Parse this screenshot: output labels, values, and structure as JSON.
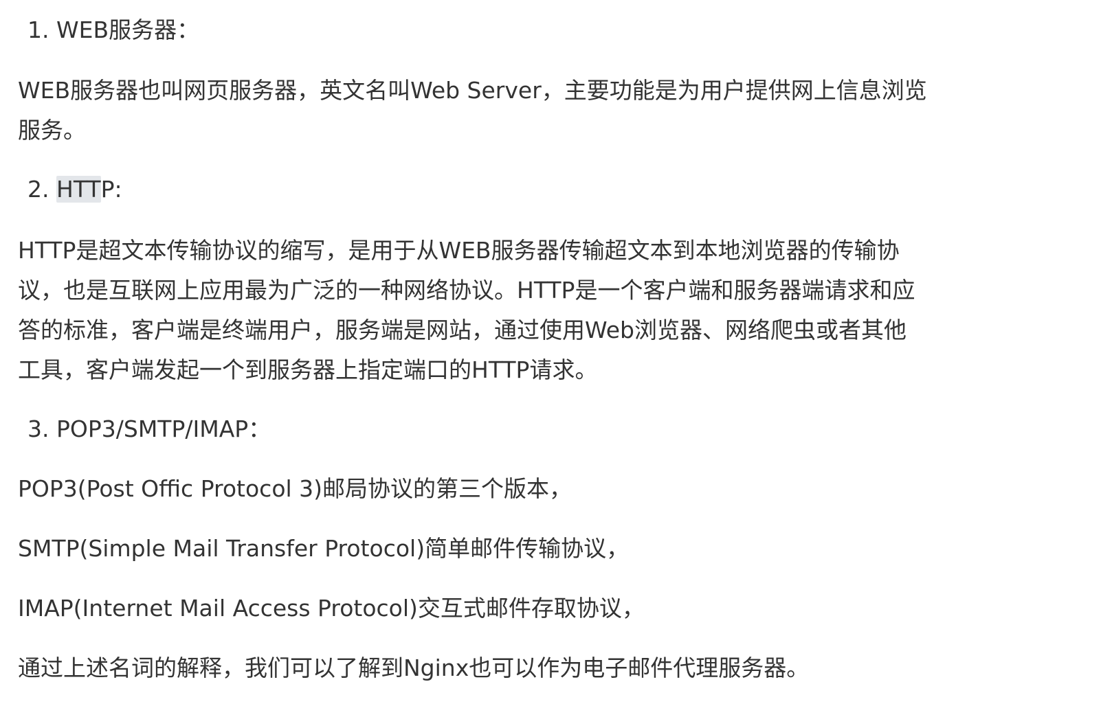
{
  "sections": [
    {
      "number": "1.",
      "title": "WEB服务器：",
      "paragraph_lines": [
        "WEB服务器也叫网页服务器，英文名叫Web Server，主要功能是为用户提供网上信息浏览",
        "服务。"
      ]
    },
    {
      "number": "2.",
      "title_highlighted": "HTT",
      "title_rest": "P:",
      "paragraph_lines": [
        "HTTP是超文本传输协议的缩写，是用于从WEB服务器传输超文本到本地浏览器的传输协",
        "议，也是互联网上应用最为广泛的一种网络协议。HTTP是一个客户端和服务器端请求和应",
        "答的标准，客户端是终端用户，服务端是网站，通过使用Web浏览器、网络爬虫或者其他",
        "工具，客户端发起一个到服务器上指定端口的HTTP请求。"
      ]
    },
    {
      "number": "3.",
      "title": "POP3/SMTP/IMAP：",
      "paragraphs": [
        "POP3(Post Offic Protocol 3)邮局协议的第三个版本，",
        "SMTP(Simple Mail Transfer Protocol)简单邮件传输协议，",
        "IMAP(Internet Mail Access Protocol)交互式邮件存取协议，",
        "通过上述名词的解释，我们可以了解到Nginx也可以作为电子邮件代理服务器。"
      ]
    }
  ]
}
